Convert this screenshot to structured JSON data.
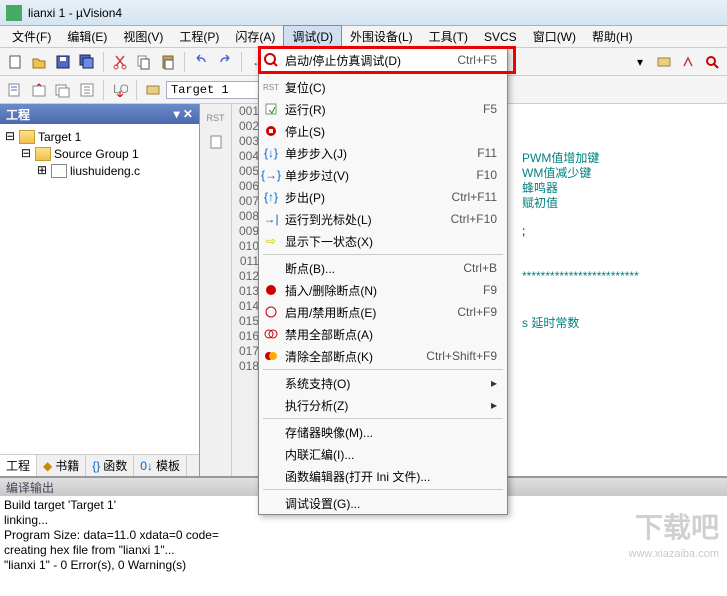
{
  "window": {
    "title": "lianxi 1 - µVision4"
  },
  "menu": {
    "file": "文件(F)",
    "edit": "编辑(E)",
    "view": "视图(V)",
    "project": "工程(P)",
    "flash": "闪存(A)",
    "debug": "调试(D)",
    "peripherals": "外围设备(L)",
    "tools": "工具(T)",
    "svcs": "SVCS",
    "window": "窗口(W)",
    "help": "帮助(H)"
  },
  "toolbar2": {
    "target": "Target 1"
  },
  "project_panel": {
    "title": "工程",
    "root": "Target 1",
    "group": "Source Group 1",
    "file": "liushuideng.c",
    "tabs": {
      "project": "工程",
      "books": "书籍",
      "functions": "函数",
      "templates": "模板"
    }
  },
  "editor": {
    "lines": [
      "001",
      "002",
      "003",
      "004",
      "005",
      "006",
      "007",
      "008",
      "009",
      "010",
      "011",
      "012",
      "013",
      "014",
      "015",
      "016",
      "017",
      "018"
    ],
    "visible_code": {
      "l4": "PWM值增加键",
      "l5": "WM值减少键",
      "l6": "蜂鸣器",
      "l7": "赋初值",
      "l9": ";",
      "l12": "*************************",
      "l15": "s 延时常数"
    }
  },
  "debug_menu": {
    "start_stop": {
      "label": "启动/停止仿真调试(D)",
      "shortcut": "Ctrl+F5"
    },
    "reset": {
      "label": "复位(C)"
    },
    "run": {
      "label": "运行(R)",
      "shortcut": "F5"
    },
    "stop": {
      "label": "停止(S)"
    },
    "step_into": {
      "label": "单步步入(J)",
      "shortcut": "F11"
    },
    "step_over": {
      "label": "单步步过(V)",
      "shortcut": "F10"
    },
    "step_out": {
      "label": "步出(P)",
      "shortcut": "Ctrl+F11"
    },
    "run_to_cursor": {
      "label": "运行到光标处(L)",
      "shortcut": "Ctrl+F10"
    },
    "show_next": {
      "label": "显示下一状态(X)"
    },
    "breakpoints": {
      "label": "断点(B)...",
      "shortcut": "Ctrl+B"
    },
    "insert_remove_bp": {
      "label": "插入/删除断点(N)",
      "shortcut": "F9"
    },
    "enable_disable_bp": {
      "label": "启用/禁用断点(E)",
      "shortcut": "Ctrl+F9"
    },
    "disable_all_bp": {
      "label": "禁用全部断点(A)"
    },
    "kill_all_bp": {
      "label": "清除全部断点(K)",
      "shortcut": "Ctrl+Shift+F9"
    },
    "os_support": {
      "label": "系统支持(O)"
    },
    "exec_profiling": {
      "label": "执行分析(Z)"
    },
    "memory_map": {
      "label": "存储器映像(M)..."
    },
    "inline_asm": {
      "label": "内联汇编(I)..."
    },
    "func_editor": {
      "label": "函数编辑器(打开 Ini 文件)..."
    },
    "debug_settings": {
      "label": "调试设置(G)..."
    }
  },
  "output": {
    "title": "编译输出",
    "lines": [
      "Build target 'Target 1'",
      "linking...",
      "Program Size: data=11.0 xdata=0 code=",
      "creating hex file from \"lianxi 1\"...",
      "\"lianxi 1\" - 0 Error(s), 0 Warning(s)"
    ]
  },
  "watermark": {
    "text": "下载吧",
    "url": "www.xiazaiba.com"
  }
}
